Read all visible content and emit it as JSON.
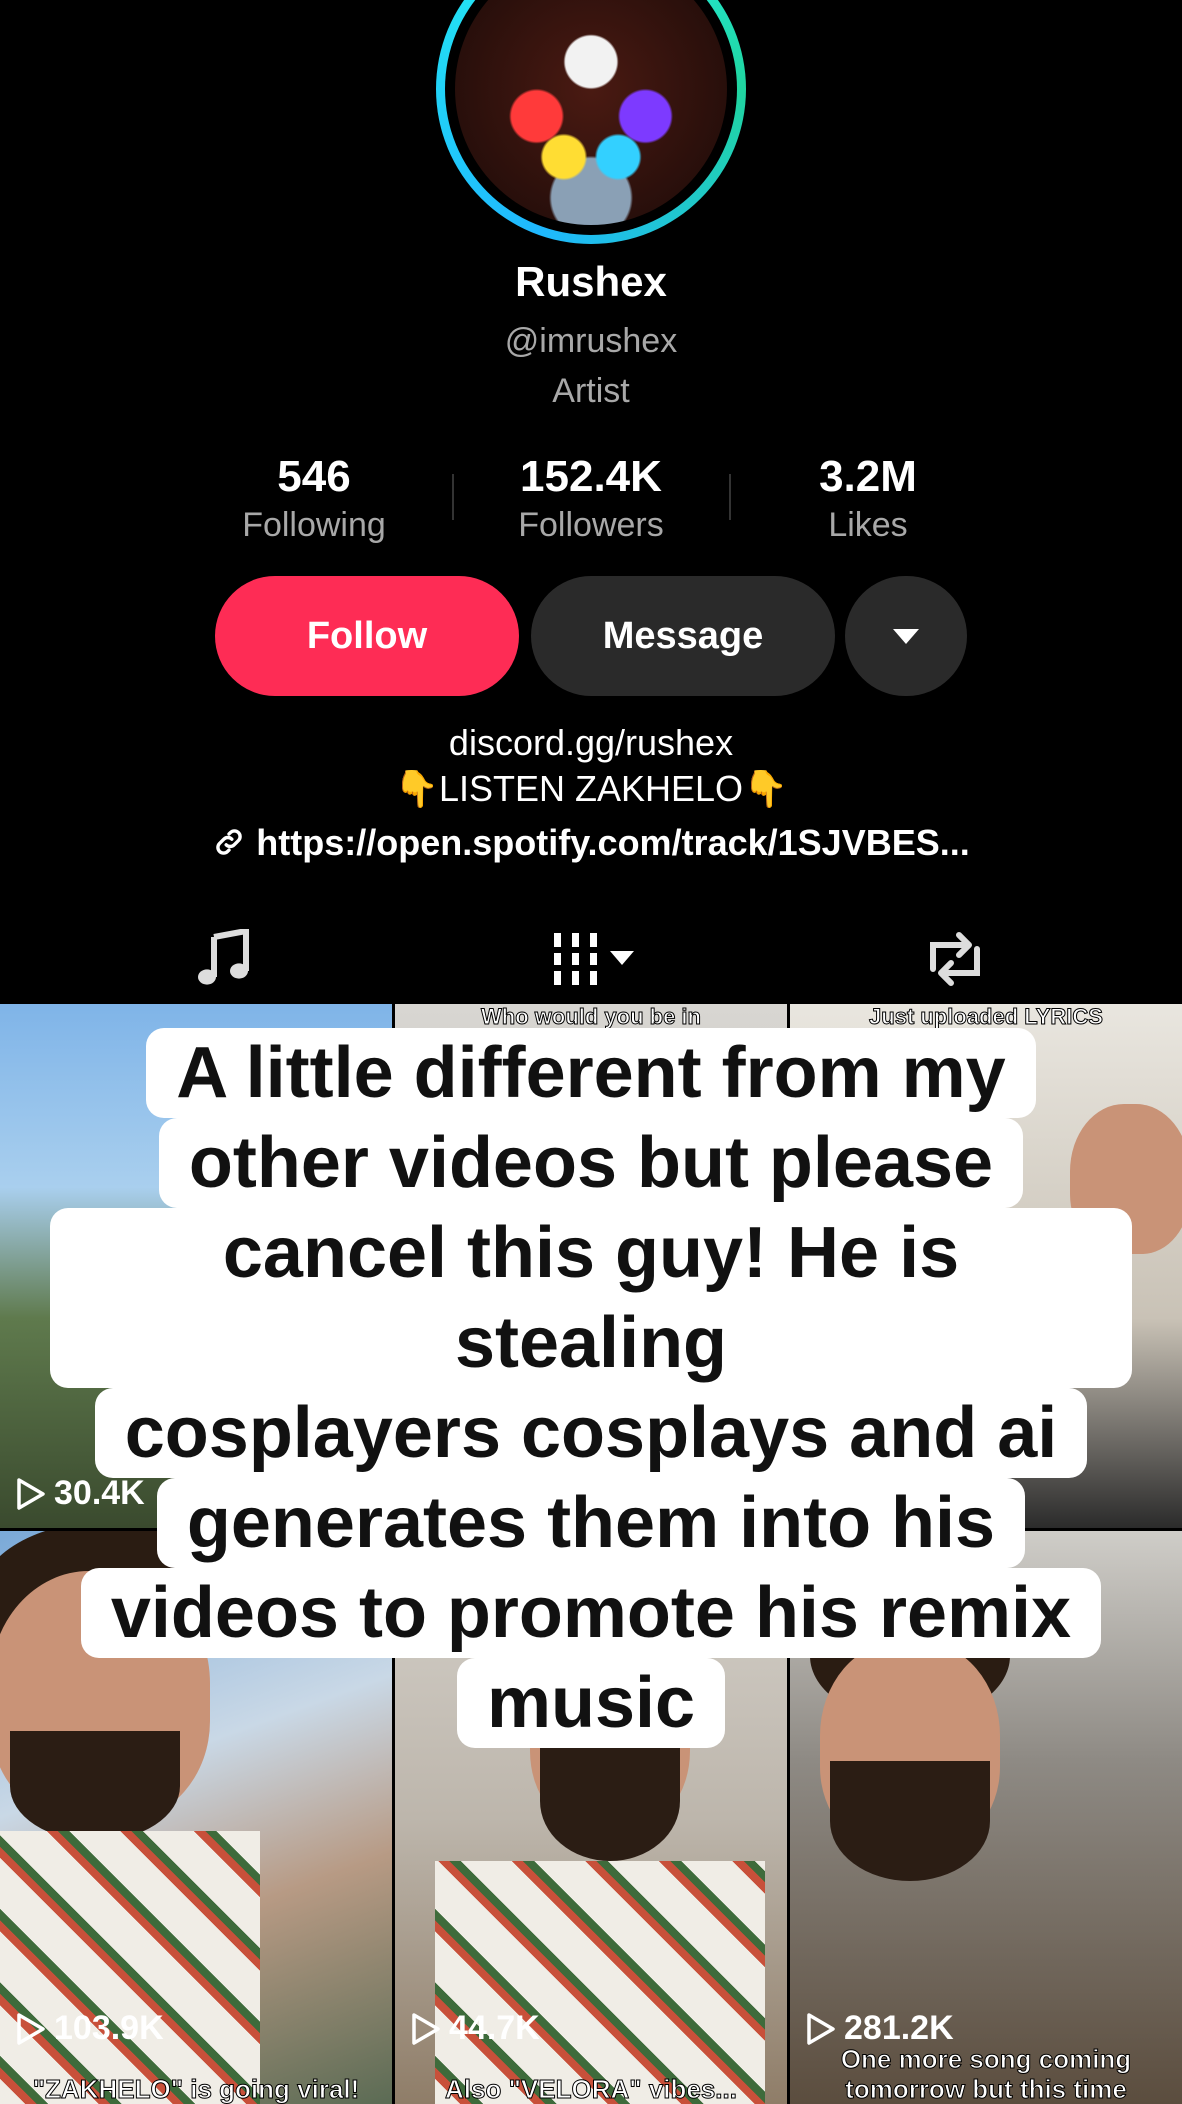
{
  "profile": {
    "display_name": "Rushex",
    "handle": "@imrushex",
    "category": "Artist"
  },
  "stats": [
    {
      "value": "546",
      "label": "Following"
    },
    {
      "value": "152.4K",
      "label": "Followers"
    },
    {
      "value": "3.2M",
      "label": "Likes"
    }
  ],
  "actions": {
    "follow_label": "Follow",
    "message_label": "Message",
    "more_icon": "caret-down-icon"
  },
  "bio": {
    "line1": "discord.gg/rushex",
    "line2": "LISTEN ZAKHELO",
    "hand_emoji": "👇",
    "link": "https://open.spotify.com/track/1SJVBES..."
  },
  "tabs": [
    {
      "icon": "music-note-icon"
    },
    {
      "icon": "grid-sort-icon"
    },
    {
      "icon": "repost-icon"
    }
  ],
  "videos": [
    {
      "top_caption": "",
      "views": "30.4K",
      "bottom_caption": ""
    },
    {
      "top_caption": "Who would you be in",
      "views": "",
      "bottom_caption": ""
    },
    {
      "top_caption": "Just uploaded LYRICS",
      "views": "",
      "bottom_caption": ""
    },
    {
      "top_caption": "",
      "views": "103.9K",
      "bottom_caption": "\"ZAKHELO\" is going viral!"
    },
    {
      "top_caption": "",
      "views": "44.7K",
      "bottom_caption": "Also \"VELORA\" vibes..."
    },
    {
      "top_caption": "",
      "views": "281.2K",
      "bottom_caption": "One more song coming tomorrow but this time"
    }
  ],
  "overlay_caption": [
    "A little different from my",
    "other videos but please",
    "cancel this guy! He is stealing",
    "cosplayers cosplays and ai",
    "generates them into his",
    "videos to promote his remix",
    "music"
  ],
  "colors": {
    "follow": "#fe2c55",
    "ring": "#25f4ee",
    "background": "#000000"
  }
}
